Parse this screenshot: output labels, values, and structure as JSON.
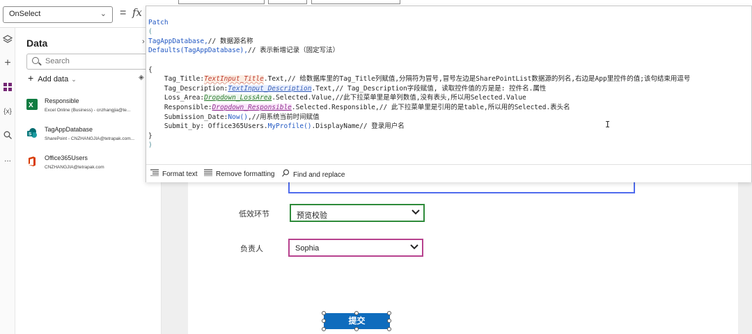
{
  "formula_bar": {
    "property": "OnSelect",
    "equals": "=",
    "fx": "fx"
  },
  "rail": {
    "icons": [
      "layers-icon",
      "plus-icon",
      "grid-icon",
      "variables-icon",
      "search-icon",
      "more-icon"
    ],
    "variables_label": "{x}",
    "more_label": "..."
  },
  "data_panel": {
    "title": "Data",
    "search_placeholder": "Search",
    "add_data_label": "Add data",
    "sources": [
      {
        "name": "Responsible",
        "detail": "Excel Online (Business) - cnzhangjia@te...",
        "color": "#107c41"
      },
      {
        "name": "TagAppDatabase",
        "detail": "SharePoint - CNZHANGJIA@tetrapak.com...",
        "color": "#038387"
      },
      {
        "name": "Office365Users",
        "detail": "CNZHANGJIA@tetrapak.com",
        "color": "#d83b01"
      }
    ]
  },
  "editor": {
    "lines": {
      "l1": "Patch",
      "l2": "(",
      "l3a": "TagAppDatabase,",
      "l3b": "// 数据源名称",
      "l4a": "Defaults(TagAppDatabase),",
      "l4b": "// 表示新增记录（固定写法）",
      "l6": "{",
      "l7a": "    Tag_Title:",
      "l7b": "TextInput_Title",
      "l7c": ".Text,// 给数据库里的Tag_Title列赋值,分隔符为冒号,冒号左边是SharePointList数据源的列名,右边是App里控件的值;该句结束用逗号",
      "l8a": "    Tag_Description:",
      "l8b": "TextInput_Description",
      "l8c": ".Text,// Tag_Description字段赋值, 读取控件值的方是是: 控件名.属性",
      "l9a": "    Loss_Area:",
      "l9b": "Dropdown_LossArea",
      "l9c": ".Selected.Value,//此下拉菜单里是单列数值,没有表头,所以用Selected.Value",
      "l10a": "    Responsible:",
      "l10b": "Dropdown_Responsible",
      "l10c": ".Selected.Responsible,// 此下拉菜单里是引用的是table,所以用的Selected.表头名",
      "l11a": "    Submission_Date:",
      "l11b": "Now()",
      "l11c": ",//用系统当前时间赋值",
      "l12a": "    Submit_by: Office365Users.",
      "l12b": "MyProfile()",
      "l12c": ".DisplayName// 登录用户名",
      "l13": "}",
      "l14": ")"
    },
    "toolbar": {
      "format_text": "Format text",
      "remove_formatting": "Remove formatting",
      "find_replace": "Find and replace"
    }
  },
  "canvas": {
    "loss_label": "低效环节",
    "loss_value": "预览校验",
    "loss_border": "#2e8b3a",
    "resp_label": "负责人",
    "resp_value": "Sophia",
    "resp_border": "#b7428e",
    "submit_label": "提交",
    "submit_color": "#0f6cbd"
  }
}
